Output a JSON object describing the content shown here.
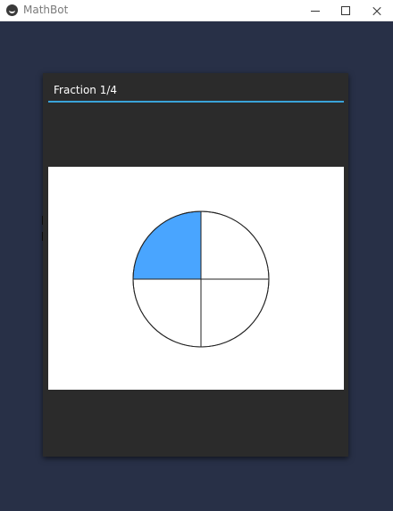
{
  "window": {
    "title": "MathBot"
  },
  "dialog": {
    "title": "Fraction 1/4"
  },
  "fraction": {
    "numerator": 1,
    "denominator": 4,
    "parts": 4,
    "shaded_parts": 1,
    "shaded_color": "#49a5ff",
    "unshaded_color": "#ffffff"
  },
  "colors": {
    "background": "#283047",
    "dialog": "#2b2b2b",
    "accent": "#39a3d8"
  },
  "icons": {
    "app": "kivy-logo-icon",
    "minimize": "minimize-icon",
    "maximize": "maximize-icon",
    "close": "close-icon"
  }
}
